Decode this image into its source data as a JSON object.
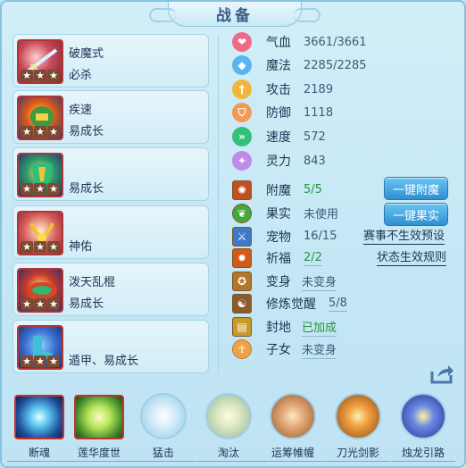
{
  "title": "战备",
  "equipment": [
    {
      "name": "破魔式",
      "sub": "必杀"
    },
    {
      "name": "疾速",
      "sub": "易成长"
    },
    {
      "name": "",
      "sub": "易成长"
    },
    {
      "name": "",
      "sub": "神佑"
    },
    {
      "name": "泼天乱棍",
      "sub": "易成长"
    },
    {
      "name": "",
      "sub": "遁甲、易成长"
    }
  ],
  "stars": "★",
  "stats": [
    {
      "label": "气血",
      "value": "3661/3661",
      "icon": "heart-icon",
      "color": "#f06a88"
    },
    {
      "label": "魔法",
      "value": "2285/2285",
      "icon": "mana-icon",
      "color": "#5ab4f0"
    },
    {
      "label": "攻击",
      "value": "2189",
      "icon": "attack-icon",
      "color": "#f2b53a"
    },
    {
      "label": "防御",
      "value": "1118",
      "icon": "defense-icon",
      "color": "#f29a55"
    },
    {
      "label": "速度",
      "value": "572",
      "icon": "speed-icon",
      "color": "#33c07a"
    },
    {
      "label": "灵力",
      "value": "843",
      "icon": "spirit-icon",
      "color": "#c08be8"
    }
  ],
  "info": [
    {
      "label": "附魔",
      "value": "5/5",
      "green": true,
      "icon": "enchant-icon"
    },
    {
      "label": "果实",
      "value": "未使用",
      "green": false,
      "icon": "fruit-icon"
    },
    {
      "label": "宠物",
      "value": "16/15",
      "green": false,
      "icon": "pet-icon"
    },
    {
      "label": "祈福",
      "value": "2/2",
      "green": true,
      "icon": "bless-icon"
    },
    {
      "label": "变身",
      "value": "未变身",
      "green": false,
      "icon": "transform-icon"
    },
    {
      "label": "修炼觉醒",
      "value": "5/8",
      "green": false,
      "icon": "cultivate-icon"
    },
    {
      "label": "封地",
      "value": "已加成",
      "green": true,
      "icon": "fief-icon"
    },
    {
      "label": "子女",
      "value": "未变身",
      "green": false,
      "icon": "child-icon"
    }
  ],
  "buttons": {
    "enchant": "一键附魔",
    "fruit": "一键果实"
  },
  "links": {
    "event_preset": "赛事不生效预设",
    "status_rule": "状态生效规则"
  },
  "skills": [
    "断魂",
    "莲华度世",
    "猛击",
    "淘汰",
    "运筹帷幄",
    "刀光剑影",
    "烛龙引路"
  ],
  "share_icon": "share-icon"
}
